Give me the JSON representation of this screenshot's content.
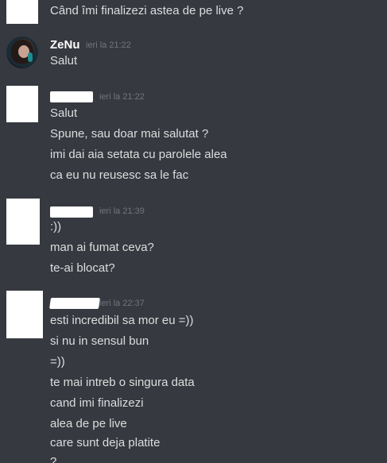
{
  "messages": [
    {
      "author": "",
      "timestamp": "",
      "lines": [
        "Când îmi finalizezi astea de pe live ?"
      ]
    },
    {
      "author": "ZeNu",
      "timestamp": "ieri la 21:22",
      "lines": [
        "Salut"
      ]
    },
    {
      "author": "",
      "timestamp": "ieri la 21:22",
      "lines": [
        "Salut",
        "Spune,  sau doar mai salutat ?",
        "imi dai aia setata cu parolele alea",
        "ca eu nu reusesc sa le fac"
      ]
    },
    {
      "author": "",
      "timestamp": "ieri la 21:39",
      "lines": [
        ":))",
        "man ai fumat ceva?",
        "te-ai blocat?"
      ]
    },
    {
      "author": "",
      "timestamp": "ieri la 22:37",
      "lines": [
        "esti incredibil sa mor eu =))",
        "si nu in sensul bun",
        "=))",
        "te mai intreb o singura data",
        "cand imi finalizezi",
        "alea de pe live",
        "care sunt deja platite",
        "?"
      ]
    }
  ],
  "colors": {
    "background": "#36393f",
    "username": "#ffffff",
    "text": "#dcddde",
    "timestamp": "#72767d",
    "redaction": "#ffffff"
  }
}
